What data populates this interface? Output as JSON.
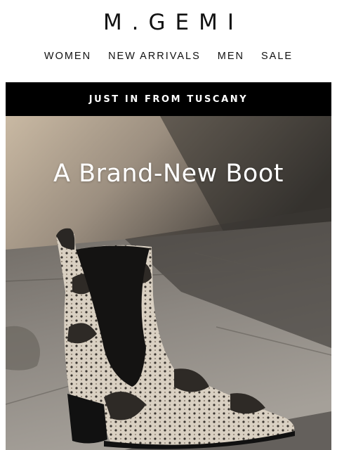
{
  "brand": {
    "logo_text": "M.GEMI"
  },
  "nav": {
    "items": [
      {
        "label": "WOMEN"
      },
      {
        "label": "NEW ARRIVALS"
      },
      {
        "label": "MEN"
      },
      {
        "label": "SALE"
      }
    ]
  },
  "banner": {
    "text": "JUST IN FROM TUSCANY"
  },
  "hero": {
    "headline": "A Brand-New Boot",
    "image": "snakeskin-chelsea-boot-photo"
  },
  "colors": {
    "banner_bg": "#000000",
    "text_primary": "#111111",
    "hero_text": "#ffffff"
  }
}
